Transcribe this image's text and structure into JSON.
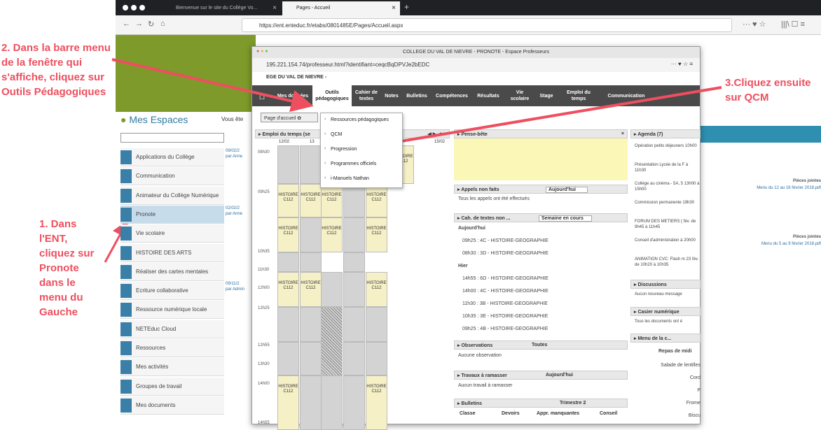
{
  "browser": {
    "tab1": "Bienvenue sur le site du Collège Vo...",
    "tab2": "Pages - Accueil",
    "url": "https://ent.enteduc.fr/etabs/0801485E/Pages/Accueil.aspx"
  },
  "ent": {
    "mes_espaces": "Mes Espaces",
    "vous": "Vous ête",
    "menu": [
      "Applications du Collège",
      "Communication",
      "Animateur du Collège Numérique",
      "Pronote",
      "Vie scolaire",
      "HISTOIRE DES ARTS",
      "Réaliser des cartes mentales",
      "Ecriture collaborative",
      "Ressource numérique locale",
      "NETEduc Cloud",
      "Ressources",
      "Mes activités",
      "Groupes de travail",
      "Mes documents"
    ],
    "posts": [
      {
        "date": "09/02/2",
        "by": "par Anne"
      },
      {
        "date": "02/02/2",
        "by": "par Anne"
      },
      {
        "date": "09/11/2",
        "by": "par Admin"
      }
    ],
    "pieces": [
      {
        "label": "Pièces jointes",
        "file": "Menu du 12 au 16 février 2018.pdf"
      },
      {
        "label": "Pièces jointes",
        "file": "Menu du 5 au 9 février 2018.pdf"
      }
    ]
  },
  "pronote": {
    "window_title": "COLLEGE DU VAL DE NIEVRE - PRONOTE - Espace Professeurs",
    "url": "195.221.154.74/professeur.html?identifiant=ceqcBqDPVJe2bEDC",
    "school": "EGE DU VAL DE NIEVRE -",
    "nav": [
      "Mes données",
      "Outils pédagogiques",
      "Cahier de textes",
      "Notes",
      "Bulletins",
      "Compétences",
      "Résultats",
      "Vie scolaire",
      "Stage",
      "Emploi du temps",
      "Communication"
    ],
    "page_accueil": "Page d'accueil",
    "dropdown": [
      "Ressources pédagogiques",
      "QCM",
      "Progression",
      "Programmes officiels",
      "i-Manuels Nathan"
    ],
    "edt_title": "Emploi du temps (se",
    "edt_dates": [
      "12/02",
      "13",
      "15/02"
    ],
    "times": [
      "08h30",
      "09h25",
      "10h35",
      "11h30",
      "12h00",
      "12h25",
      "12h55",
      "13h30",
      "14h00",
      "14h55"
    ],
    "pense_bete": "Pense-bête",
    "appels": "Appels non faits",
    "appels_sel": "Aujourd'hui",
    "appels_msg": "Tous les appels ont été effectués",
    "cahier": "Cah. de textes non ...",
    "cahier_sel": "Semaine en cours",
    "aujourdhui": "Aujourd'hui",
    "hier": "Hier",
    "cahier_rows_today": [
      "09h25 : 4C - HISTOIRE-GEOGRAPHIE",
      "08h30 : 3D - HISTOIRE-GEOGRAPHIE"
    ],
    "cahier_rows_hier": [
      "14h55 : 6D - HISTOIRE-GEOGRAPHIE",
      "14h00 : 4C - HISTOIRE-GEOGRAPHIE",
      "11h30 : 3B - HISTOIRE-GEOGRAPHIE",
      "10h35 : 3E - HISTOIRE-GEOGRAPHIE",
      "09h25 : 4B - HISTOIRE-GEOGRAPHIE"
    ],
    "observations": "Observations",
    "obs_sel": "Toutes",
    "obs_msg": "Aucune observation",
    "travaux": "Travaux à ramasser",
    "trav_sel": "Aujourd'hui",
    "trav_msg": "Aucun travail à ramasser",
    "bulletins": "Bulletins",
    "bull_sel": "Trimestre 2",
    "bull_cols": [
      "Classe",
      "Devoirs",
      "Appr. manquantes",
      "Conseil"
    ],
    "agenda": "Agenda (7)",
    "agenda_items": [
      "Opération petits déjeuners 10h00",
      "Présentation Lycée de la F à 11h30",
      "Collège au cinéma - 5A, 5 13h00 à 15h00",
      "Commission permanente 19h30",
      "FORUM DES METIERS ( fév. de 9h45 à 11h45",
      "Conseil d'administration à 20h00",
      "ANIMATION CVC: Flash m 23 fév. de 10h20 à 10h35"
    ],
    "discussions": "Discussions",
    "disc_msg": "Aucun nouveau message",
    "casier": "Casier numérique",
    "casier_msg": "Tous les documents ont é",
    "menu_c": "Menu de la c...",
    "repas": "Repas de midi",
    "menu_items": [
      "Salade de lentilles",
      "Cord",
      "P",
      "Frome",
      "Biscu"
    ],
    "cells": {
      "histoire": "HISTOIRE",
      "rooms": "C112"
    }
  },
  "annotations": {
    "step1": "1. Dans l'ENT, cliquez sur Pronote dans le menu du Gauche",
    "step2": "2. Dans la barre menu de la fenêtre qui s'affiche, cliquez sur Outils Pédagogiques",
    "step3": "3.Cliquez ensuite sur QCM"
  }
}
